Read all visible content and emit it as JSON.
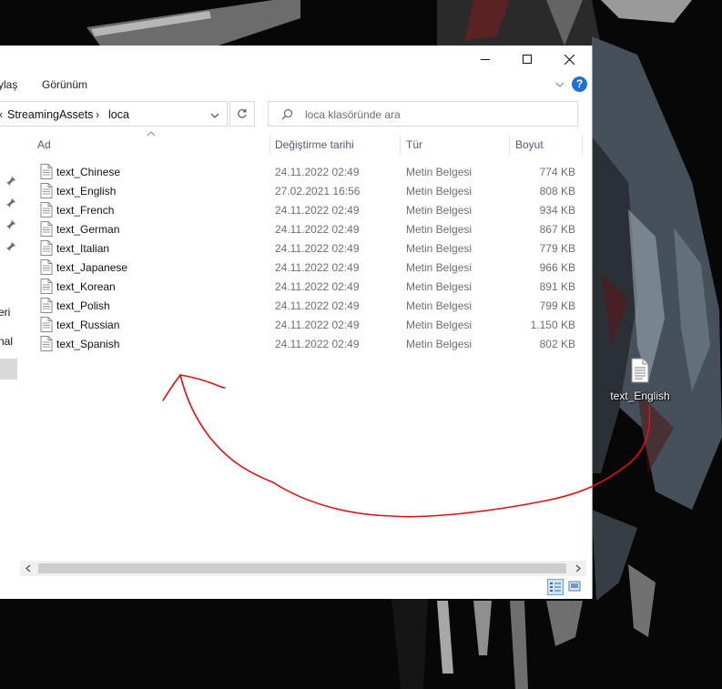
{
  "desktop": {
    "icon_label": "text_English"
  },
  "window": {
    "ribbon_tabs": [
      "ylaş",
      "Görünüm"
    ],
    "address": {
      "left_arrow": "‹",
      "path": [
        "StreamingAssets",
        "loca"
      ],
      "separator": "›"
    },
    "search_placeholder": "loca klasöründe ara",
    "nav_fragments": [
      "eri",
      "nal"
    ],
    "columns": {
      "name": "Ad",
      "date": "Değiştirme tarihi",
      "type": "Tür",
      "size": "Boyut"
    },
    "files": [
      {
        "name": "text_Chinese",
        "date": "24.11.2022 02:49",
        "type": "Metin Belgesi",
        "size": "774 KB"
      },
      {
        "name": "text_English",
        "date": "27.02.2021 16:56",
        "type": "Metin Belgesi",
        "size": "808 KB"
      },
      {
        "name": "text_French",
        "date": "24.11.2022 02:49",
        "type": "Metin Belgesi",
        "size": "934 KB"
      },
      {
        "name": "text_German",
        "date": "24.11.2022 02:49",
        "type": "Metin Belgesi",
        "size": "867 KB"
      },
      {
        "name": "text_Italian",
        "date": "24.11.2022 02:49",
        "type": "Metin Belgesi",
        "size": "779 KB"
      },
      {
        "name": "text_Japanese",
        "date": "24.11.2022 02:49",
        "type": "Metin Belgesi",
        "size": "966 KB"
      },
      {
        "name": "text_Korean",
        "date": "24.11.2022 02:49",
        "type": "Metin Belgesi",
        "size": "891 KB"
      },
      {
        "name": "text_Polish",
        "date": "24.11.2022 02:49",
        "type": "Metin Belgesi",
        "size": "799 KB"
      },
      {
        "name": "text_Russian",
        "date": "24.11.2022 02:49",
        "type": "Metin Belgesi",
        "size": "1.150 KB"
      },
      {
        "name": "text_Spanish",
        "date": "24.11.2022 02:49",
        "type": "Metin Belgesi",
        "size": "802 KB"
      }
    ]
  },
  "colors": {
    "annotation_arrow": "#e01010",
    "column_header": "#4b5c7a",
    "help_icon": "#1e6fd9"
  }
}
